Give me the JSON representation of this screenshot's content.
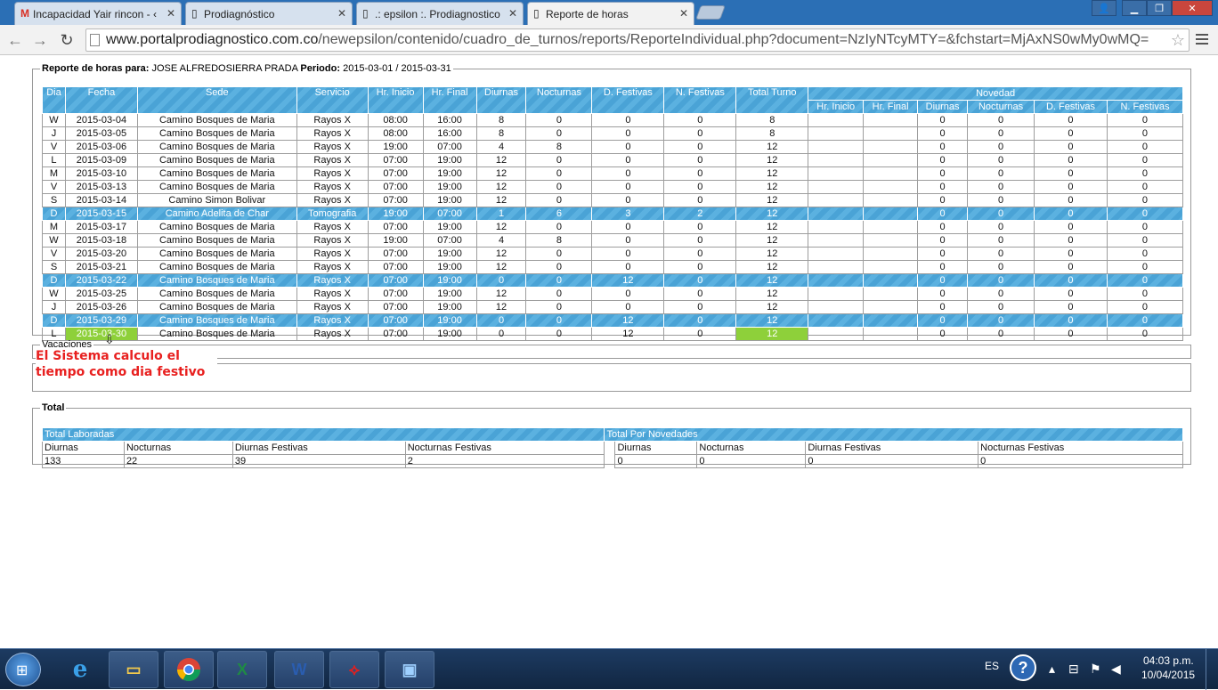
{
  "browser": {
    "tabs": [
      {
        "label": "Incapacidad Yair rincon - ‹",
        "icon": "gmail-icon"
      },
      {
        "label": "Prodiagnóstico",
        "icon": "page-icon"
      },
      {
        "label": ".: epsilon :. Prodiagnostico",
        "icon": "page-icon"
      },
      {
        "label": "Reporte de horas",
        "icon": "page-icon"
      }
    ],
    "url_host": "www.portalprodiagnostico.com.co",
    "url_path": "/newepsilon/contenido/cuadro_de_turnos/reports/ReporteIndividual.php?document=NzIyNTcyMTY=&fchstart=MjAxNS0wMy0wMQ="
  },
  "report": {
    "legend_label": "Reporte de horas para:",
    "employee": "JOSE ALFREDOSIERRA PRADA",
    "period_label": "Periodo:",
    "period": "2015-03-01 / 2015-03-31",
    "headers": [
      "Dia",
      "Fecha",
      "Sede",
      "Servicio",
      "Hr. Inicio",
      "Hr. Final",
      "Diurnas",
      "Nocturnas",
      "D. Festivas",
      "N. Festivas",
      "Total Turno"
    ],
    "novedad_header": "Novedad",
    "novedad_subheaders": [
      "Hr. Inicio",
      "Hr. Final",
      "Diurnas",
      "Nocturnas",
      "D. Festivas",
      "N. Festivas"
    ],
    "rows": [
      {
        "dia": "W",
        "fecha": "2015-03-04",
        "sede": "Camino Bosques de Maria",
        "servicio": "Rayos X",
        "ini": "08:00",
        "fin": "16:00",
        "diu": "8",
        "noc": "0",
        "dfe": "0",
        "nfe": "0",
        "tot": "8",
        "nov": [
          "",
          "",
          "0",
          "0",
          "0",
          "0"
        ],
        "festivo": false
      },
      {
        "dia": "J",
        "fecha": "2015-03-05",
        "sede": "Camino Bosques de Maria",
        "servicio": "Rayos X",
        "ini": "08:00",
        "fin": "16:00",
        "diu": "8",
        "noc": "0",
        "dfe": "0",
        "nfe": "0",
        "tot": "8",
        "nov": [
          "",
          "",
          "0",
          "0",
          "0",
          "0"
        ],
        "festivo": false
      },
      {
        "dia": "V",
        "fecha": "2015-03-06",
        "sede": "Camino Bosques de Maria",
        "servicio": "Rayos X",
        "ini": "19:00",
        "fin": "07:00",
        "diu": "4",
        "noc": "8",
        "dfe": "0",
        "nfe": "0",
        "tot": "12",
        "nov": [
          "",
          "",
          "0",
          "0",
          "0",
          "0"
        ],
        "festivo": false
      },
      {
        "dia": "L",
        "fecha": "2015-03-09",
        "sede": "Camino Bosques de Maria",
        "servicio": "Rayos X",
        "ini": "07:00",
        "fin": "19:00",
        "diu": "12",
        "noc": "0",
        "dfe": "0",
        "nfe": "0",
        "tot": "12",
        "nov": [
          "",
          "",
          "0",
          "0",
          "0",
          "0"
        ],
        "festivo": false
      },
      {
        "dia": "M",
        "fecha": "2015-03-10",
        "sede": "Camino Bosques de Maria",
        "servicio": "Rayos X",
        "ini": "07:00",
        "fin": "19:00",
        "diu": "12",
        "noc": "0",
        "dfe": "0",
        "nfe": "0",
        "tot": "12",
        "nov": [
          "",
          "",
          "0",
          "0",
          "0",
          "0"
        ],
        "festivo": false
      },
      {
        "dia": "V",
        "fecha": "2015-03-13",
        "sede": "Camino Bosques de Maria",
        "servicio": "Rayos X",
        "ini": "07:00",
        "fin": "19:00",
        "diu": "12",
        "noc": "0",
        "dfe": "0",
        "nfe": "0",
        "tot": "12",
        "nov": [
          "",
          "",
          "0",
          "0",
          "0",
          "0"
        ],
        "festivo": false
      },
      {
        "dia": "S",
        "fecha": "2015-03-14",
        "sede": "Camino Simon Bolivar",
        "servicio": "Rayos X",
        "ini": "07:00",
        "fin": "19:00",
        "diu": "12",
        "noc": "0",
        "dfe": "0",
        "nfe": "0",
        "tot": "12",
        "nov": [
          "",
          "",
          "0",
          "0",
          "0",
          "0"
        ],
        "festivo": false
      },
      {
        "dia": "D",
        "fecha": "2015-03-15",
        "sede": "Camino Adelita de Char",
        "servicio": "Tomografia",
        "ini": "19:00",
        "fin": "07:00",
        "diu": "1",
        "noc": "6",
        "dfe": "3",
        "nfe": "2",
        "tot": "12",
        "nov": [
          "",
          "",
          "0",
          "0",
          "0",
          "0"
        ],
        "festivo": true
      },
      {
        "dia": "M",
        "fecha": "2015-03-17",
        "sede": "Camino Bosques de Maria",
        "servicio": "Rayos X",
        "ini": "07:00",
        "fin": "19:00",
        "diu": "12",
        "noc": "0",
        "dfe": "0",
        "nfe": "0",
        "tot": "12",
        "nov": [
          "",
          "",
          "0",
          "0",
          "0",
          "0"
        ],
        "festivo": false
      },
      {
        "dia": "W",
        "fecha": "2015-03-18",
        "sede": "Camino Bosques de Maria",
        "servicio": "Rayos X",
        "ini": "19:00",
        "fin": "07:00",
        "diu": "4",
        "noc": "8",
        "dfe": "0",
        "nfe": "0",
        "tot": "12",
        "nov": [
          "",
          "",
          "0",
          "0",
          "0",
          "0"
        ],
        "festivo": false
      },
      {
        "dia": "V",
        "fecha": "2015-03-20",
        "sede": "Camino Bosques de Maria",
        "servicio": "Rayos X",
        "ini": "07:00",
        "fin": "19:00",
        "diu": "12",
        "noc": "0",
        "dfe": "0",
        "nfe": "0",
        "tot": "12",
        "nov": [
          "",
          "",
          "0",
          "0",
          "0",
          "0"
        ],
        "festivo": false
      },
      {
        "dia": "S",
        "fecha": "2015-03-21",
        "sede": "Camino Bosques de Maria",
        "servicio": "Rayos X",
        "ini": "07:00",
        "fin": "19:00",
        "diu": "12",
        "noc": "0",
        "dfe": "0",
        "nfe": "0",
        "tot": "12",
        "nov": [
          "",
          "",
          "0",
          "0",
          "0",
          "0"
        ],
        "festivo": false
      },
      {
        "dia": "D",
        "fecha": "2015-03-22",
        "sede": "Camino Bosques de Maria",
        "servicio": "Rayos X",
        "ini": "07:00",
        "fin": "19:00",
        "diu": "0",
        "noc": "0",
        "dfe": "12",
        "nfe": "0",
        "tot": "12",
        "nov": [
          "",
          "",
          "0",
          "0",
          "0",
          "0"
        ],
        "festivo": true
      },
      {
        "dia": "W",
        "fecha": "2015-03-25",
        "sede": "Camino Bosques de Maria",
        "servicio": "Rayos X",
        "ini": "07:00",
        "fin": "19:00",
        "diu": "12",
        "noc": "0",
        "dfe": "0",
        "nfe": "0",
        "tot": "12",
        "nov": [
          "",
          "",
          "0",
          "0",
          "0",
          "0"
        ],
        "festivo": false
      },
      {
        "dia": "J",
        "fecha": "2015-03-26",
        "sede": "Camino Bosques de Maria",
        "servicio": "Rayos X",
        "ini": "07:00",
        "fin": "19:00",
        "diu": "12",
        "noc": "0",
        "dfe": "0",
        "nfe": "0",
        "tot": "12",
        "nov": [
          "",
          "",
          "0",
          "0",
          "0",
          "0"
        ],
        "festivo": false
      },
      {
        "dia": "D",
        "fecha": "2015-03-29",
        "sede": "Camino Bosques de Maria",
        "servicio": "Rayos X",
        "ini": "07:00",
        "fin": "19:00",
        "diu": "0",
        "noc": "0",
        "dfe": "12",
        "nfe": "0",
        "tot": "12",
        "nov": [
          "",
          "",
          "0",
          "0",
          "0",
          "0"
        ],
        "festivo": true
      },
      {
        "dia": "L",
        "fecha": "2015-03-30",
        "sede": "Camino Bosques de Maria",
        "servicio": "Rayos X",
        "ini": "07:00",
        "fin": "19:00",
        "diu": "0",
        "noc": "0",
        "dfe": "12",
        "nfe": "0",
        "tot": "12",
        "nov": [
          "",
          "",
          "0",
          "0",
          "0",
          "0"
        ],
        "festivo": false,
        "highlight": true
      }
    ],
    "colors": {
      "header_blue": "#4aa3d6",
      "highlight_green": "#8ed03a",
      "annotation_red": "#e8201f"
    }
  },
  "vacaciones": {
    "legend": "Vacaciones"
  },
  "annotation": {
    "text": "El Sistema calculo el tiempo como dia festivo"
  },
  "total": {
    "legend": "Total",
    "laboradas_header": "Total Laboradas",
    "novedades_header": "Total Por Novedades",
    "labels": [
      "Diurnas",
      "Nocturnas",
      "Diurnas Festivas",
      "Nocturnas Festivas"
    ],
    "laboradas_values": [
      "133",
      "22",
      "39",
      "2"
    ],
    "novedades_values": [
      "0",
      "0",
      "0",
      "0"
    ]
  },
  "taskbar": {
    "apps": [
      "ie-icon",
      "explorer-icon",
      "chrome-icon",
      "excel-icon",
      "word-icon",
      "acrobat-icon",
      "remote-desktop-icon"
    ],
    "language": "ES",
    "time": "04:03 p.m.",
    "date": "10/04/2015"
  }
}
